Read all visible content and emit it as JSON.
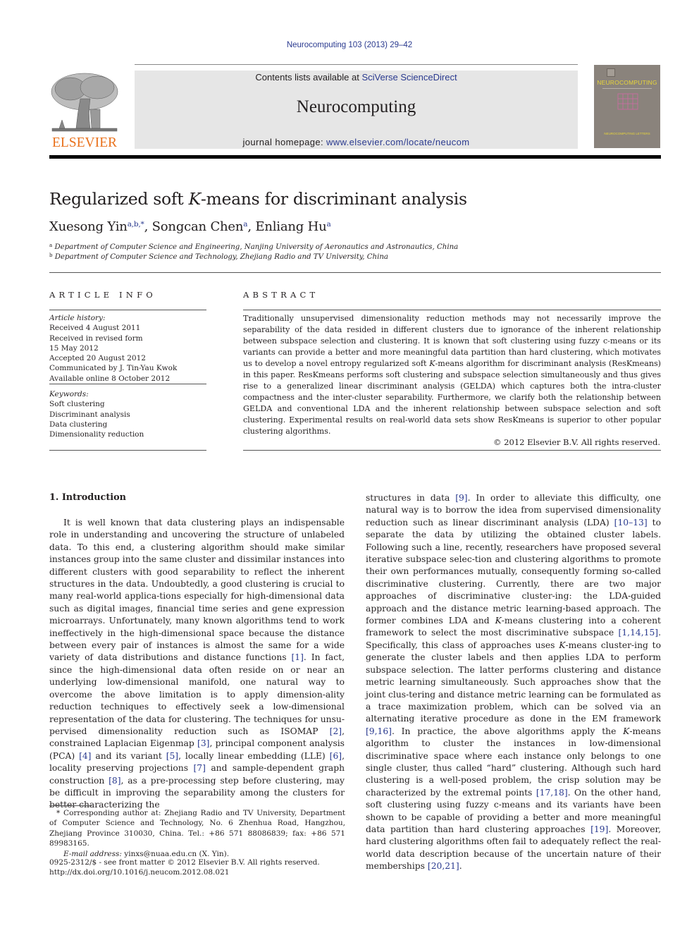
{
  "header": {
    "journal_ref": "Neurocomputing 103 (2013) 29–42",
    "contents_prefix": "Contents lists available at ",
    "contents_link": "SciVerse ScienceDirect",
    "journal_name": "Neurocomputing",
    "homepage_prefix": "journal homepage: ",
    "homepage_link": "www.elsevier.com/locate/neucom",
    "publisher_logo": "ELSEVIER",
    "cover_title": "NEUROCOMPUTING",
    "cover_subtitle": "NEUROCOMPUTING LETTERS",
    "colors": {
      "link": "#2a3a8f",
      "elsevier_orange": "#e9711c",
      "band_gray": "#e6e6e6",
      "cover_gray": "#8a837c",
      "cover_yellow": "#e8d53a"
    }
  },
  "article": {
    "title_pre": "Regularized soft ",
    "title_k": "K",
    "title_post": "-means for discriminant analysis",
    "authors": [
      {
        "name": "Xuesong Yin",
        "sup": "a,b,*"
      },
      {
        "name": "Songcan Chen",
        "sup": "a"
      },
      {
        "name": "Enliang Hu",
        "sup": "a"
      }
    ],
    "affiliations": [
      {
        "mark": "a",
        "text": "Department of Computer Science and Engineering, Nanjing University of Aeronautics and Astronautics, China"
      },
      {
        "mark": "b",
        "text": "Department of Computer Science and Technology, Zhejiang Radio and TV University, China"
      }
    ]
  },
  "article_info": {
    "heading": "ARTICLE INFO",
    "history_label": "Article history:",
    "history": [
      "Received 4 August 2011",
      "Received in revised form",
      "15 May 2012",
      "Accepted 20 August 2012",
      "Communicated by J. Tin-Yau Kwok",
      "Available online 8 October 2012"
    ],
    "keywords_label": "Keywords:",
    "keywords": [
      "Soft clustering",
      "Discriminant analysis",
      "Data clustering",
      "Dimensionality reduction"
    ]
  },
  "abstract": {
    "heading": "ABSTRACT",
    "text_1": "Traditionally unsupervised dimensionality reduction methods may not necessarily improve the separability of the data resided in different clusters due to ignorance of the inherent relationship between subspace selection and clustering. It is known that soft clustering using fuzzy c-means or its variants can provide a better and more meaningful data partition than hard clustering, which motivates us to develop a novel entropy regularized soft ",
    "text_k": "K",
    "text_2": "-means algorithm for discriminant analysis (ResKmeans) in this paper. ResKmeans performs soft clustering and subspace selection simultaneously and thus gives rise to a generalized linear discriminant analysis (GELDA) which captures both the intra-cluster compactness and the inter-cluster separability. Furthermore, we clarify both the relationship between GELDA and conventional LDA and the inherent relationship between subspace selection and soft clustering. Experimental results on real-world data sets show ResKmeans is superior to other popular clustering algorithms.",
    "copyright": "© 2012 Elsevier B.V. All rights reserved."
  },
  "body": {
    "section_heading": "1.  Introduction",
    "left_segments": [
      "It is well known that data clustering plays an indispensable role in understanding and uncovering the structure of unlabeled data. To this end, a clustering algorithm should make similar instances group into the same cluster and dissimilar instances into different clusters with good separability to reflect the inherent structures in the data. Undoubtedly, a good clustering is crucial to many real-world applica-tions especially for high-dimensional data such as digital images, financial time series and gene expression microarrays. Unfortunately, many known algorithms tend to work ineffectively in the high-dimensional space because the distance between every pair of instances is almost the same for a wide variety of data distributions and distance functions ",
      "[1]",
      ". In fact, since the high-dimensional data often reside on or near an underlying low-dimensional manifold, one natural way to overcome the above limitation is to apply dimension-ality reduction techniques to effectively seek a low-dimensional representation of the data for clustering. The techniques for unsu-pervised dimensionality reduction such as ISOMAP ",
      "[2]",
      ", constrained Laplacian Eigenmap ",
      "[3]",
      ", principal component analysis (PCA) ",
      "[4]",
      " and its variant ",
      "[5]",
      ", locally linear embedding (LLE) ",
      "[6]",
      ", locality preserving projections ",
      "[7]",
      " and sample-dependent graph construction ",
      "[8]",
      ", as a pre-processing step before clustering, may be difficult in improving the separability among the clusters for better characterizing the"
    ],
    "right_segments": [
      "structures in data ",
      "[9]",
      ". In order to alleviate this difficulty, one natural way is to borrow the idea from supervised dimensionality reduction such as linear discriminant analysis (LDA) ",
      "[10–13]",
      " to separate the data by utilizing the obtained cluster labels. Following such a line, recently, researchers have proposed several iterative subspace selec-tion and clustering algorithms to promote their own performances mutually, consequently forming so-called discriminative clustering. Currently, there are two major approaches of discriminative cluster-ing: the LDA-guided approach and the distance metric learning-based approach. The former combines LDA and ",
      "K",
      "-means clustering into a coherent framework to select the most discriminative subspace ",
      "[1,14,15]",
      ". Specifically, this class of approaches uses ",
      "K",
      "-means cluster-ing to generate the cluster labels and then applies LDA to perform subspace selection. The latter performs clustering and distance metric learning simultaneously. Such approaches show that the joint clus-tering and distance metric learning can be formulated as a trace maximization problem, which can be solved via an alternating iterative procedure as done in the EM framework ",
      "[9,16]",
      ". In practice, the above algorithms apply the ",
      "K",
      "-means algorithm to cluster the instances in low-dimensional discriminative space where each instance only belongs to one single cluster, thus called “hard” clustering. Although such hard clustering is a well-posed problem, the crisp solution may be characterized by the extremal points ",
      "[17,18]",
      ". On the other hand, soft clustering using fuzzy c-means and its variants have been shown to be capable of providing a better and more meaningful data partition than hard clustering approaches ",
      "[19]",
      ". Moreover, hard clustering algorithms often fail to adequately reflect the real-world data description because of the uncertain nature of their memberships ",
      "[20,21]",
      "."
    ]
  },
  "footnote": {
    "corresponding": "* Corresponding author at: Zhejiang Radio and TV University, Department of Computer Science and Technology, No. 6 Zhenhua Road, Hangzhou, Zhejiang Province 310030, China. Tel.: +86 571 88086839; fax: +86 571 89983165.",
    "email_label": "E-mail address:",
    "email": " yinxs@nuaa.edu.cn (X. Yin)."
  },
  "front_matter": {
    "issn_line": "0925-2312/$ - see front matter © 2012 Elsevier B.V. All rights reserved.",
    "doi": "http://dx.doi.org/10.1016/j.neucom.2012.08.021"
  }
}
